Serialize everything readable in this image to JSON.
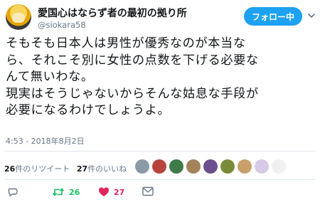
{
  "user": {
    "display_name": "愛国心はならず者の最初の拠り所",
    "handle": "@siokara58"
  },
  "follow_button_label": "フォロー中",
  "tweet": {
    "lines": [
      "そもそも日本人は男性が優秀なのが本当な",
      "ら、それこそ別に女性の点数を下げる必要な",
      "んて無いわな。",
      "現実はそうじゃないからそんな姑息な手段が",
      "必要になるわけでしょうよ。"
    ],
    "timestamp": "4:53 - 2018年8月2日"
  },
  "stats": {
    "retweet_count": "26",
    "retweet_label": "件のリツイート",
    "like_count": "27",
    "like_label": "件のいいね"
  },
  "liker_avatar_colors": [
    "#8a9aa6",
    "#b8433c",
    "#3f7a4a",
    "#a3835a",
    "#6b4f8f",
    "#7a8b3a",
    "#c9a06b",
    "#d7c9e8",
    "#f0f0f0"
  ],
  "actions": {
    "reply_count": "",
    "retweet_count": "26",
    "like_count": "27",
    "retweet_color": "#17bf63",
    "like_color": "#e0245e"
  },
  "icons": {
    "reply": "reply-icon",
    "retweet": "retweet-icon",
    "like": "heart-icon",
    "dm": "mail-icon",
    "more": "chevron-down-icon"
  }
}
